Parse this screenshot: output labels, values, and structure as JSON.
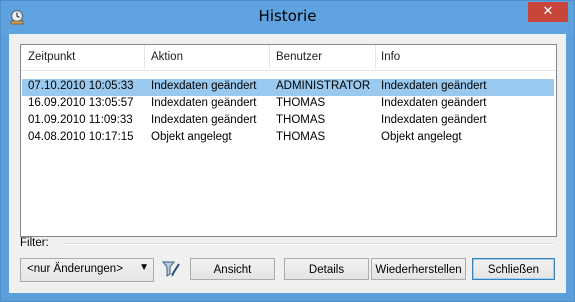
{
  "window": {
    "title": "Historie",
    "close_glyph": "✕"
  },
  "list": {
    "columns": [
      "Zeitpunkt",
      "Aktion",
      "Benutzer",
      "Info"
    ],
    "rows": [
      [
        "07.10.2010 10:05:33",
        "Indexdaten geändert",
        "ADMINISTRATOR",
        "Indexdaten geändert"
      ],
      [
        "16.09.2010 13:05:57",
        "Indexdaten geändert",
        "THOMAS",
        "Indexdaten geändert"
      ],
      [
        "01.09.2010 11:09:33",
        "Indexdaten geändert",
        "THOMAS",
        "Indexdaten geändert"
      ],
      [
        "04.08.2010 10:17:15",
        "Objekt angelegt",
        "THOMAS",
        "Objekt angelegt"
      ]
    ],
    "selected_row": 0
  },
  "filter": {
    "label": "Filter:",
    "selected": "<nur Änderungen>",
    "arrow_glyph": "▼"
  },
  "buttons": {
    "view": "Ansicht",
    "details": "Details",
    "restore": "Wiederherstellen",
    "close": "Schließen"
  },
  "colors": {
    "selection": "#99c9ef",
    "titlebar": "#5ea3e0",
    "close": "#c7453a"
  }
}
